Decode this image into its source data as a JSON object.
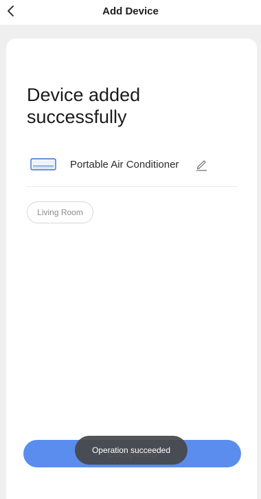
{
  "header": {
    "title": "Add Device",
    "back_icon": "chevron-left-icon"
  },
  "main": {
    "heading": "Device added successfully",
    "device": {
      "icon": "air-conditioner-icon",
      "name": "Portable Air Conditioner",
      "edit_icon": "pencil-icon"
    },
    "room": {
      "label": "Living Room"
    },
    "complete_button": {
      "label": "Completed"
    }
  },
  "toast": {
    "message": "Operation succeeded"
  },
  "colors": {
    "accent": "#5b8def",
    "page_background": "#efefef",
    "toast_background": "#464646"
  }
}
